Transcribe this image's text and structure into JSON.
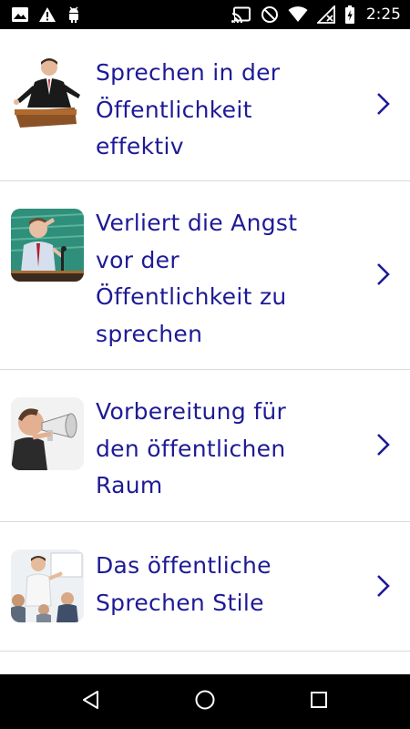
{
  "status_bar": {
    "time": "2:25",
    "left_icons": [
      "image-icon",
      "warning-icon",
      "android-debug-icon"
    ],
    "right_icons": [
      "cast-icon",
      "do-not-disturb-icon",
      "wifi-icon",
      "no-signal-icon",
      "battery-icon"
    ]
  },
  "topics": [
    {
      "title": "Sprechen in der\nÖffentlichkeit\neffektiv",
      "image": "speaker-at-podium-image"
    },
    {
      "title": "Verliert die Angst\nvor der\nÖffentlichkeit zu\nsprechen",
      "image": "nervous-speaker-image"
    },
    {
      "title": "Vorbereitung für\nden öffentlichen\nRaum",
      "image": "megaphone-man-image"
    },
    {
      "title": "Das öffentliche\nSprechen Stile",
      "image": "presenter-audience-image"
    }
  ],
  "colors": {
    "title": "#1e1a96",
    "chevron": "#1e1a96",
    "divider": "#d9d9d9",
    "bars": "#000000"
  },
  "navigation": [
    "back-icon",
    "home-icon",
    "recents-icon"
  ]
}
